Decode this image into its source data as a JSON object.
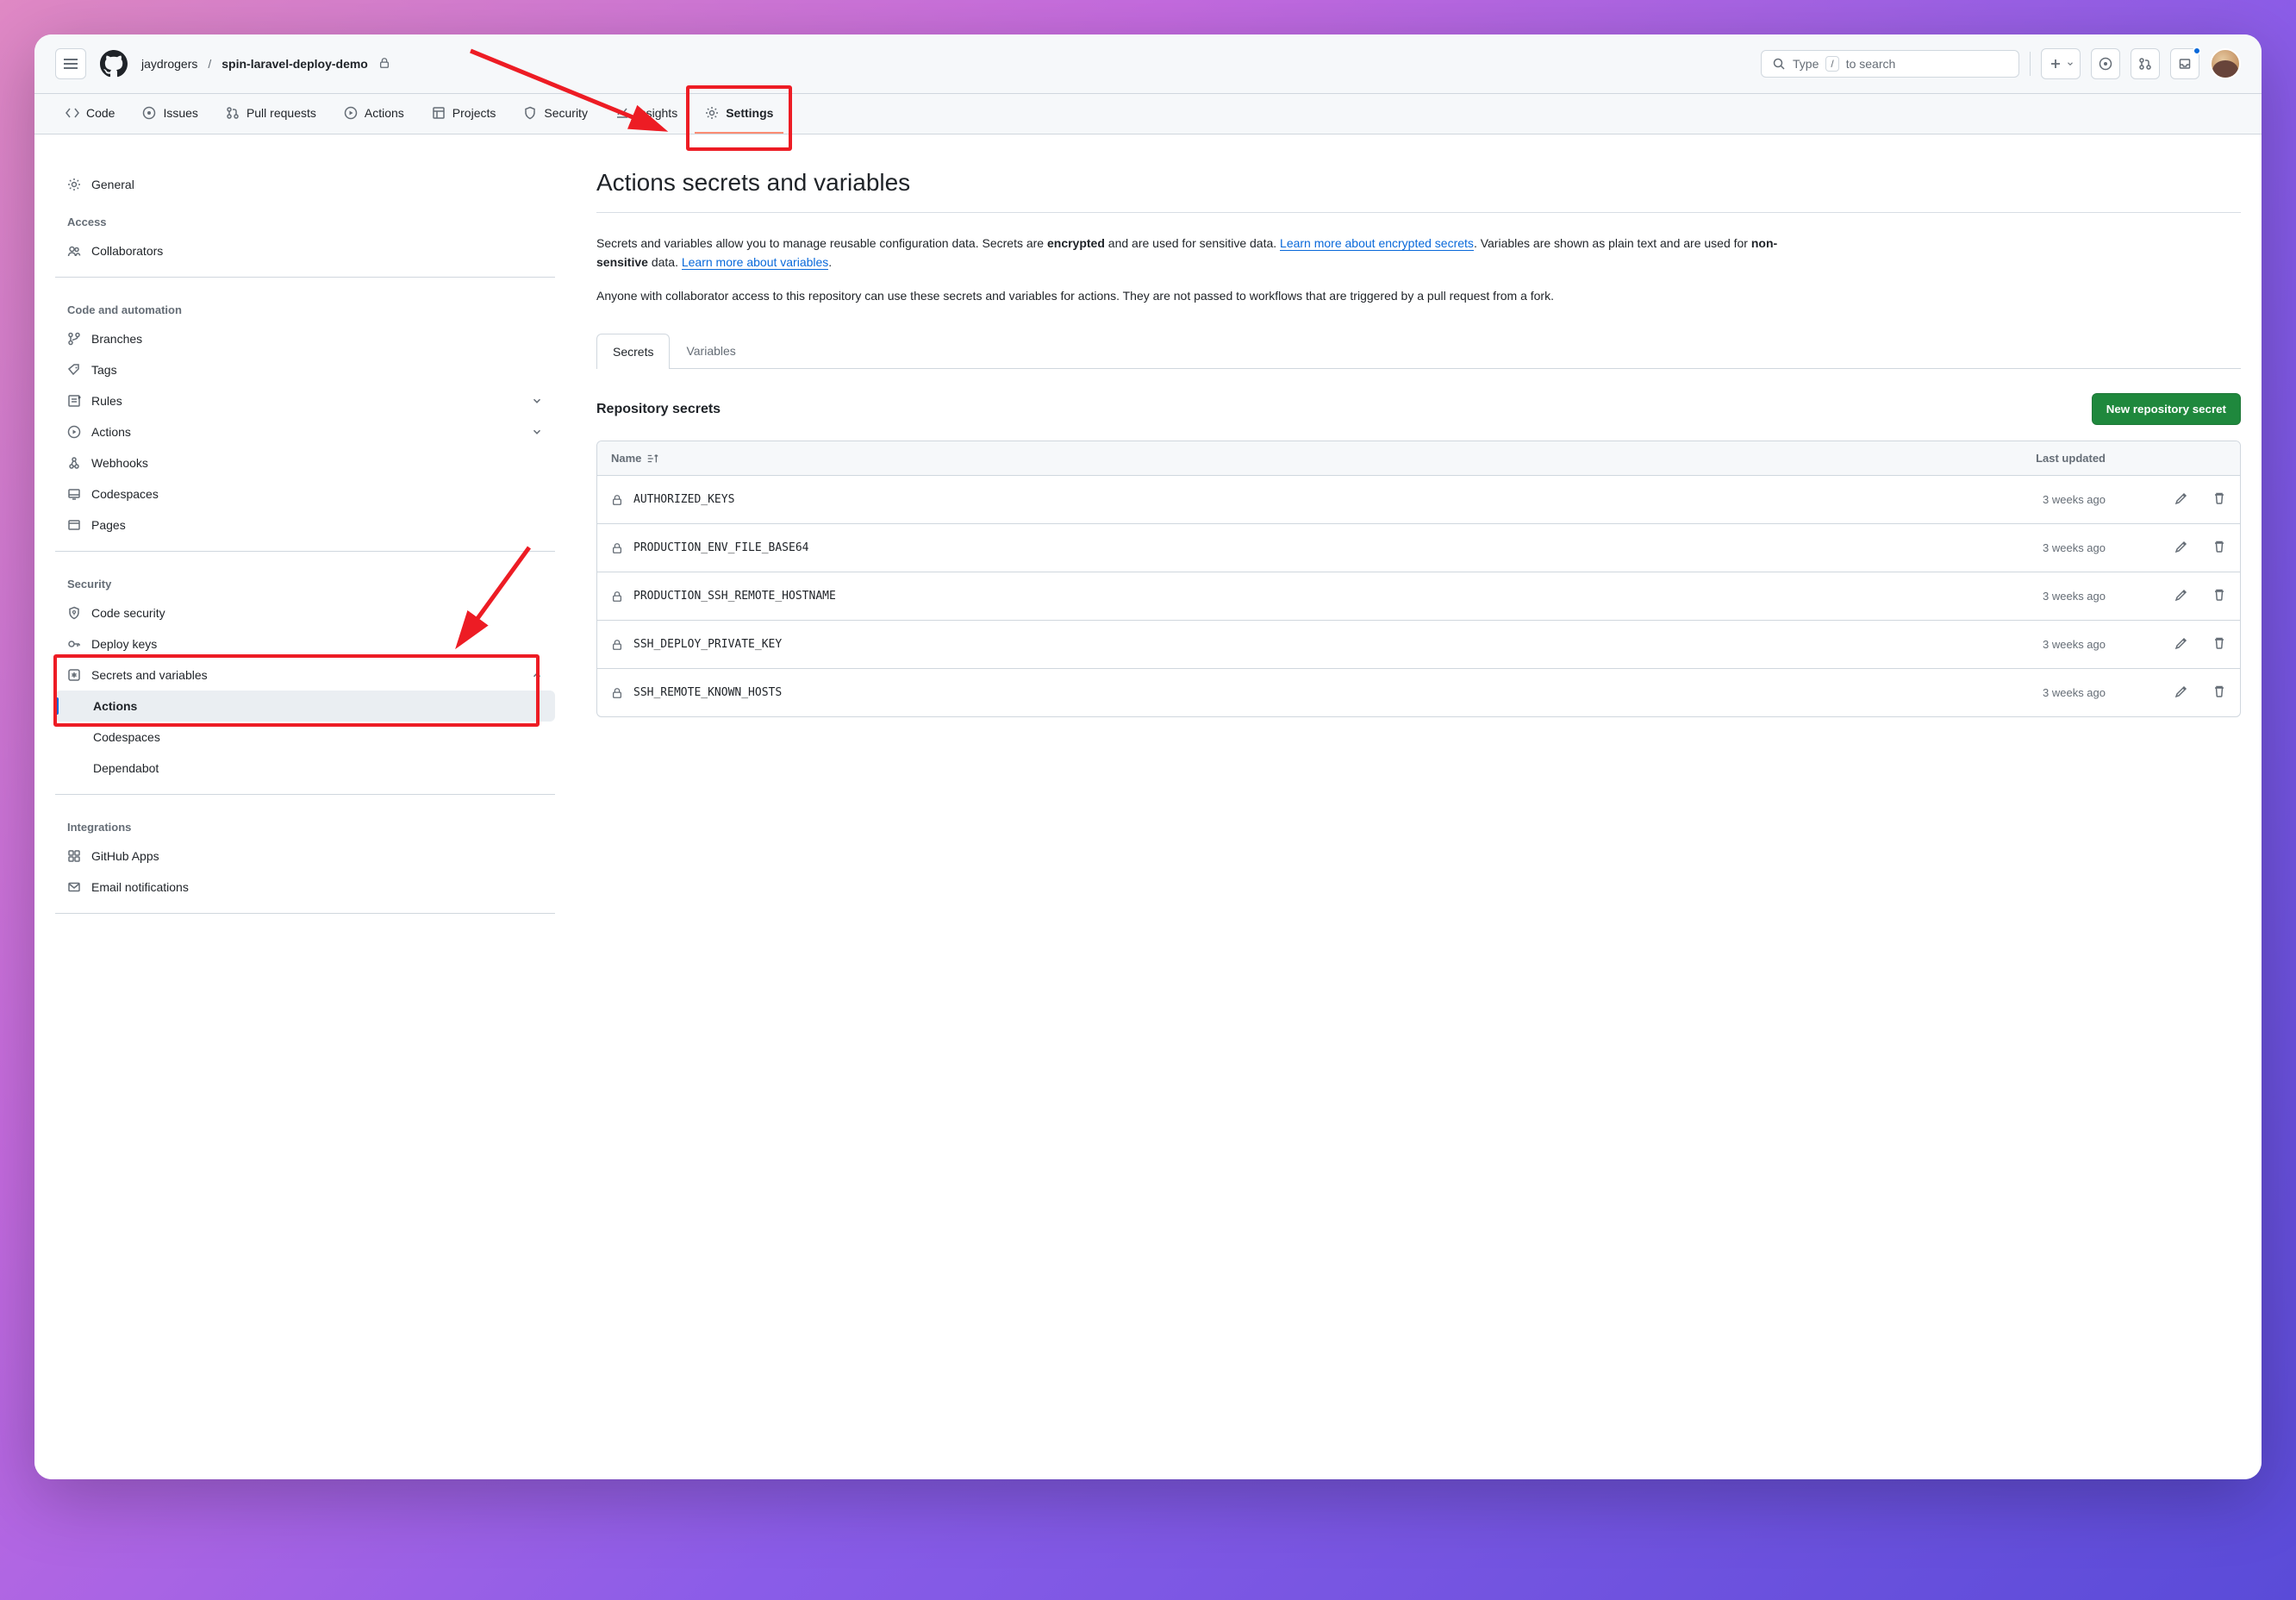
{
  "header": {
    "owner": "jaydrogers",
    "repo": "spin-laravel-deploy-demo"
  },
  "search": {
    "prefix": "Type",
    "suffix": "to search",
    "kbd": "/"
  },
  "nav": [
    {
      "label": "Code",
      "icon": "code"
    },
    {
      "label": "Issues",
      "icon": "issue"
    },
    {
      "label": "Pull requests",
      "icon": "pr"
    },
    {
      "label": "Actions",
      "icon": "play"
    },
    {
      "label": "Projects",
      "icon": "table"
    },
    {
      "label": "Security",
      "icon": "shield"
    },
    {
      "label": "Insights",
      "icon": "graph"
    },
    {
      "label": "Settings",
      "icon": "gear",
      "selected": true
    }
  ],
  "sidebar": {
    "general": "General",
    "groups": [
      {
        "head": "Access",
        "items": [
          {
            "label": "Collaborators",
            "icon": "people"
          }
        ]
      },
      {
        "head": "Code and automation",
        "items": [
          {
            "label": "Branches",
            "icon": "branch"
          },
          {
            "label": "Tags",
            "icon": "tag"
          },
          {
            "label": "Rules",
            "icon": "rules",
            "chev": "down"
          },
          {
            "label": "Actions",
            "icon": "play",
            "chev": "down"
          },
          {
            "label": "Webhooks",
            "icon": "webhook"
          },
          {
            "label": "Codespaces",
            "icon": "codespaces"
          },
          {
            "label": "Pages",
            "icon": "browser"
          }
        ]
      },
      {
        "head": "Security",
        "items": [
          {
            "label": "Code security",
            "icon": "shield-lock"
          },
          {
            "label": "Deploy keys",
            "icon": "key"
          },
          {
            "label": "Secrets and variables",
            "icon": "asterisk",
            "chev": "up",
            "expanded": true,
            "children": [
              {
                "label": "Actions",
                "active": true
              },
              {
                "label": "Codespaces"
              },
              {
                "label": "Dependabot"
              }
            ]
          }
        ]
      },
      {
        "head": "Integrations",
        "items": [
          {
            "label": "GitHub Apps",
            "icon": "apps"
          },
          {
            "label": "Email notifications",
            "icon": "mail"
          }
        ]
      }
    ]
  },
  "main": {
    "title": "Actions secrets and variables",
    "p1_a": "Secrets and variables allow you to manage reusable configuration data. Secrets are ",
    "p1_b": "encrypted",
    "p1_c": " and are used for sensitive data. ",
    "p1_link1": "Learn more about encrypted secrets",
    "p1_d": ". Variables are shown as plain text and are used for ",
    "p1_e": "non-sensitive",
    "p1_f": " data. ",
    "p1_link2": "Learn more about variables",
    "p1_g": ".",
    "p2": "Anyone with collaborator access to this repository can use these secrets and variables for actions. They are not passed to workflows that are triggered by a pull request from a fork.",
    "tabs": [
      {
        "label": "Secrets",
        "selected": true
      },
      {
        "label": "Variables"
      }
    ],
    "section_title": "Repository secrets",
    "new_button": "New repository secret",
    "col_name": "Name",
    "col_updated": "Last updated",
    "rows": [
      {
        "name": "AUTHORIZED_KEYS",
        "updated": "3 weeks ago"
      },
      {
        "name": "PRODUCTION_ENV_FILE_BASE64",
        "updated": "3 weeks ago"
      },
      {
        "name": "PRODUCTION_SSH_REMOTE_HOSTNAME",
        "updated": "3 weeks ago"
      },
      {
        "name": "SSH_DEPLOY_PRIVATE_KEY",
        "updated": "3 weeks ago"
      },
      {
        "name": "SSH_REMOTE_KNOWN_HOSTS",
        "updated": "3 weeks ago"
      }
    ]
  }
}
